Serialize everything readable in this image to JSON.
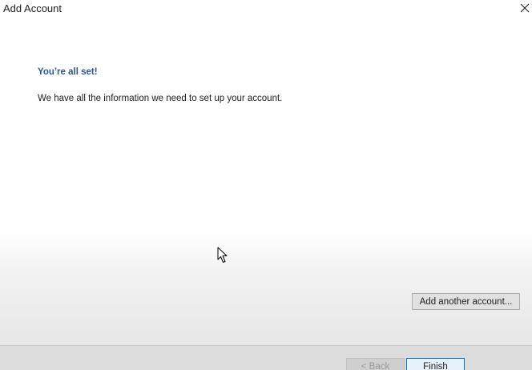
{
  "window": {
    "title": "Add Account"
  },
  "content": {
    "heading": "You’re all set!",
    "message": "We have all the information we need to set up your account."
  },
  "buttons": {
    "add_another": "Add another account...",
    "back": "< Back",
    "finish": "Finish"
  },
  "colors": {
    "heading": "#2b579a",
    "focus_border": "#0078d7"
  },
  "icons": {
    "close": "close-icon",
    "cursor": "mouse-pointer-icon"
  }
}
